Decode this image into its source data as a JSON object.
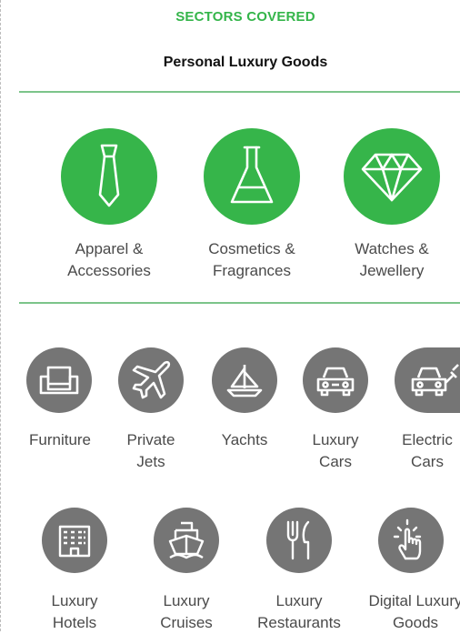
{
  "header": {
    "sectors_title": "SECTORS COVERED",
    "category_title": "Personal Luxury Goods"
  },
  "luxury_goods": [
    {
      "line1": "Apparel &",
      "line2": "Accessories",
      "icon": "tie-icon"
    },
    {
      "line1": "Cosmetics &",
      "line2": "Fragrances",
      "icon": "flask-icon"
    },
    {
      "line1": "Watches &",
      "line2": "Jewellery",
      "icon": "diamond-icon"
    }
  ],
  "experiences_row1": [
    {
      "line1": "Furniture",
      "line2": "",
      "icon": "armchair-icon"
    },
    {
      "line1": "Private",
      "line2": "Jets",
      "icon": "airplane-icon"
    },
    {
      "line1": "Yachts",
      "line2": "",
      "icon": "sailboat-icon"
    },
    {
      "line1": "Luxury",
      "line2": "Cars",
      "icon": "car-icon"
    },
    {
      "line1": "Electric",
      "line2": "Cars",
      "icon": "electric-car-icon"
    }
  ],
  "experiences_row2": [
    {
      "line1": "Luxury",
      "line2": "Hotels",
      "icon": "hotel-icon"
    },
    {
      "line1": "Luxury",
      "line2": "Cruises",
      "icon": "ship-icon"
    },
    {
      "line1": "Luxury",
      "line2": "Restaurants",
      "icon": "cutlery-icon"
    },
    {
      "line1": "Digital Luxury",
      "line2": "Goods",
      "icon": "touch-hand-icon"
    }
  ],
  "colors": {
    "accent_green": "#36b54a",
    "icon_grey": "#757575",
    "divider_green": "#7cc48a"
  }
}
